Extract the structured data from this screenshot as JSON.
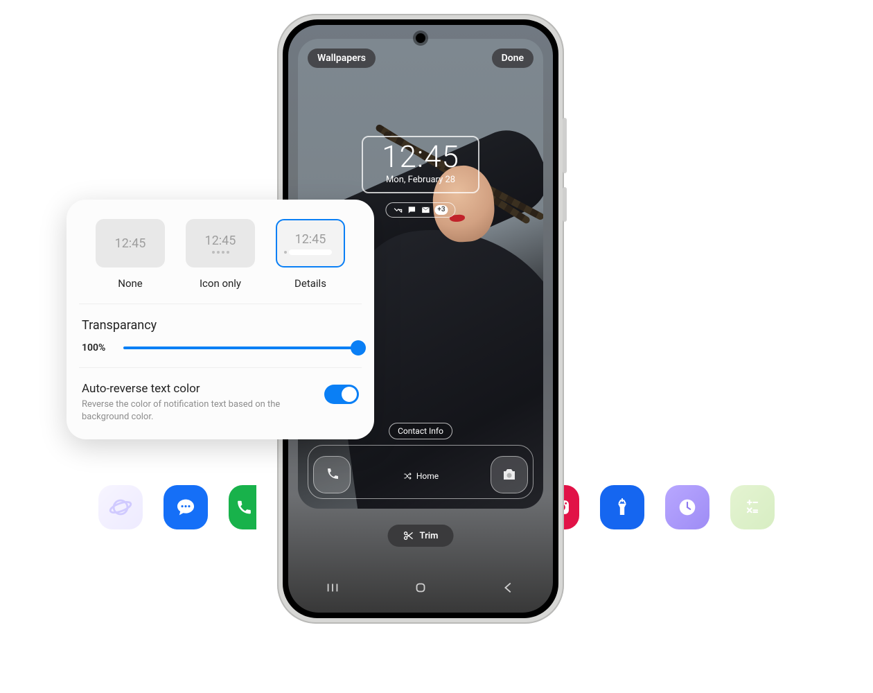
{
  "editor": {
    "wallpapers_label": "Wallpapers",
    "done_label": "Done",
    "contact_info_label": "Contact Info",
    "home_label": "Home",
    "trim_label": "Trim"
  },
  "clock": {
    "time": "12:45",
    "date": "Mon, February 28",
    "overflow_badge": "+3"
  },
  "popover": {
    "options": [
      {
        "label": "None",
        "sample": "12:45"
      },
      {
        "label": "Icon only",
        "sample": "12:45"
      },
      {
        "label": "Details",
        "sample": "12:45"
      }
    ],
    "selected_index": 2,
    "transparency_title": "Transparancy",
    "transparency_value": "100%",
    "auto_reverse_title": "Auto-reverse text color",
    "auto_reverse_desc": "Reverse the color of notification text based on the background color.",
    "auto_reverse_on": true
  },
  "colors": {
    "accent": "#0a7ff5"
  }
}
